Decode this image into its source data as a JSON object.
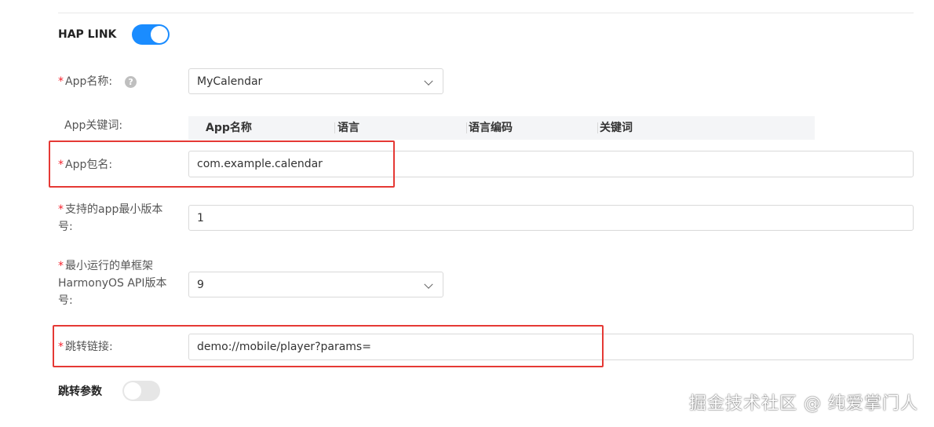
{
  "hap_link": {
    "label": "HAP LINK",
    "enabled": true
  },
  "app_name": {
    "required_mark": "*",
    "label": "App名称:",
    "help_icon": "question-circle-icon",
    "value": "MyCalendar"
  },
  "app_keywords": {
    "label": "App关键词:",
    "columns": [
      "App名称",
      "语言",
      "语言编码",
      "关键词"
    ]
  },
  "app_package": {
    "required_mark": "*",
    "label": "App包名:",
    "value": "com.example.calendar"
  },
  "min_app_version": {
    "required_mark": "*",
    "label_line1": "支持的app最小版本",
    "label_line2": "号:",
    "value": "1"
  },
  "min_api_version": {
    "required_mark": "*",
    "label_line1": "最小运行的单框架",
    "label_line2": "HarmonyOS API版本",
    "label_line3": "号:",
    "value": "9"
  },
  "jump_link": {
    "required_mark": "*",
    "label": "跳转链接:",
    "value": "demo://mobile/player?params="
  },
  "jump_params": {
    "label": "跳转参数",
    "enabled": false
  },
  "watermark": "掘金技术社区 @ 纯爱掌门人",
  "colors": {
    "accent": "#1a8cff",
    "required": "#f5222d",
    "highlight_box": "#e53935"
  }
}
